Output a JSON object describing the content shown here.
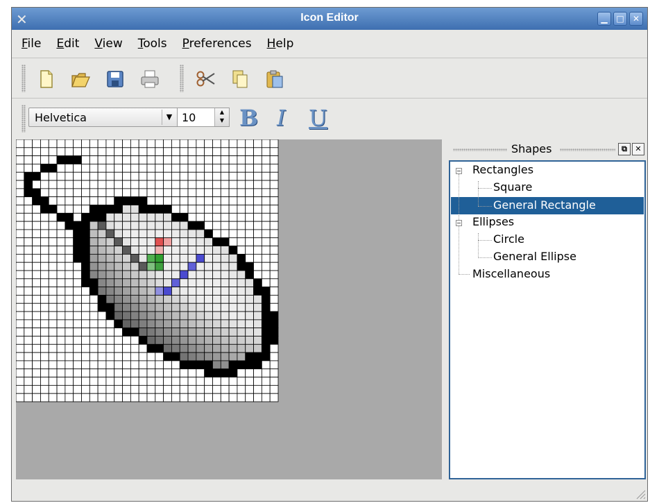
{
  "window": {
    "title": "Icon Editor"
  },
  "menu": {
    "items": [
      {
        "hot": "F",
        "rest": "ile"
      },
      {
        "hot": "E",
        "rest": "dit"
      },
      {
        "hot": "V",
        "rest": "iew"
      },
      {
        "hot": "T",
        "rest": "ools"
      },
      {
        "hot": "P",
        "rest": "references"
      },
      {
        "hot": "H",
        "rest": "elp"
      }
    ]
  },
  "toolbar": {
    "icons": [
      "new-file-icon",
      "open-folder-icon",
      "save-disk-icon",
      "print-icon",
      "cut-scissors-icon",
      "copy-icon",
      "paste-icon"
    ]
  },
  "format_toolbar": {
    "font": "Helvetica",
    "size": "10",
    "bold": "B",
    "italic": "I",
    "underline": "U"
  },
  "shapes_panel": {
    "title": "Shapes",
    "tree": [
      {
        "label": "Rectangles",
        "children": [
          "Square",
          "General Rectangle"
        ]
      },
      {
        "label": "Ellipses",
        "children": [
          "Circle",
          "General Ellipse"
        ]
      },
      {
        "label": "Miscellaneous",
        "children": []
      }
    ],
    "selected": "General Rectangle",
    "selected_color": "#1f5f98"
  },
  "icon_grid": {
    "cols": 32,
    "rows": 32
  }
}
